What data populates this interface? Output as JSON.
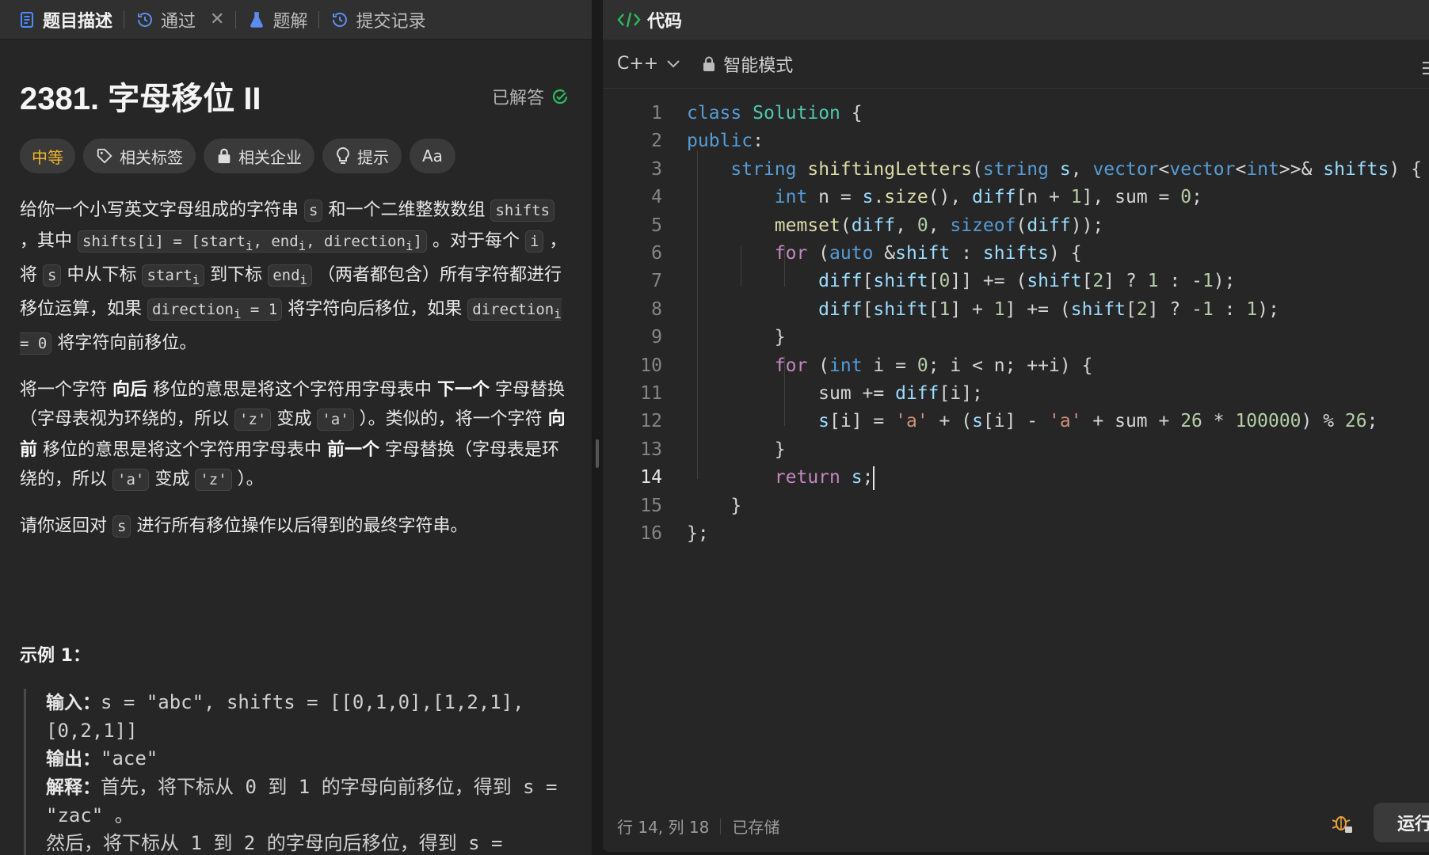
{
  "left_tabs": [
    {
      "label": "题目描述",
      "icon": "document-icon"
    },
    {
      "label": "通过",
      "icon": "history-icon"
    },
    {
      "label": "题解",
      "icon": "flask-icon"
    },
    {
      "label": "提交记录",
      "icon": "history-icon"
    }
  ],
  "problem": {
    "title": "2381. 字母移位 II",
    "status": "已解答",
    "difficulty": "中等",
    "chips": [
      "相关标签",
      "相关企业",
      "提示",
      "Aa"
    ],
    "colors": {
      "difficulty": "#f0b429",
      "solved": "#2cbb5d"
    }
  },
  "description": {
    "p1": {
      "t1": "给你一个小写英文字母组成的字符串 ",
      "c1": "s",
      "t2": " 和一个二维整数数组 ",
      "c2": "shifts",
      "t3": " ，其中 ",
      "c3": "shifts[i] = [start",
      "c3b": ", end",
      "c3c": ", direction",
      "c3d": "]",
      "t4": " 。对于每个 ",
      "c4": "i",
      "t5": " ，将 ",
      "c5": "s",
      "t6": " 中从下标 ",
      "c6": "start",
      "t7": " 到下标 ",
      "c7": "end",
      "t8": " （两者都包含）所有字符都进行移位运算，如果 ",
      "c8": "direction",
      "c8b": " = 1",
      "t9": " 将字符向后移位，如果 ",
      "c9": "direction",
      "c9b": " = 0",
      "t10": " 将字符向前移位。",
      "sub": "i"
    },
    "p2": {
      "t1": "将一个字符 ",
      "b1": "向后",
      "t2": " 移位的意思是将这个字符用字母表中 ",
      "b2": "下一个",
      "t3": " 字母替换（字母表视为环绕的，所以 ",
      "c1": "'z'",
      "t4": " 变成 ",
      "c2": "'a'",
      "t5": " ）。类似的，将一个字符 ",
      "b3": "向前",
      "t6": " 移位的意思是将这个字符用字母表中 ",
      "b4": "前一个",
      "t7": " 字母替换（字母表是环绕的，所以 ",
      "c3": "'a'",
      "t8": " 变成 ",
      "c4": "'z'",
      "t9": " ）。"
    },
    "p3": {
      "t1": "请你返回对 ",
      "c1": "s",
      "t2": " 进行所有移位操作以后得到的最终字符串。"
    }
  },
  "example": {
    "title": "示例 1：",
    "input_label": "输入：",
    "input_value": "s = \"abc\", shifts = [[0,1,0],[1,2,1],[0,2,1]]",
    "output_label": "输出：",
    "output_value": "\"ace\"",
    "explain_label": "解释：",
    "explain_value": "首先，将下标从 0 到 1 的字母向前移位，得到 s = \"zac\" 。",
    "explain_more": "然后，将下标从 1 到 2 的字母向后移位，得到 s ="
  },
  "editor": {
    "header": "代码",
    "language": "C++",
    "mode": "智能模式",
    "current_line": 14,
    "lines": [
      "class Solution {",
      "public:",
      "    string shiftingLetters(string s, vector<vector<int>>& shifts) {",
      "        int n = s.size(), diff[n + 1], sum = 0;",
      "        memset(diff, 0, sizeof(diff));",
      "        for (auto &shift : shifts) {",
      "            diff[shift[0]] += (shift[2] ? 1 : -1);",
      "            diff[shift[1] + 1] += (shift[2] ? -1 : 1);",
      "        }",
      "        for (int i = 0; i < n; ++i) {",
      "            sum += diff[i];",
      "            s[i] = 'a' + (s[i] - 'a' + sum + 26 * 100000) % 26;",
      "        }",
      "        return s;",
      "    }",
      "};"
    ]
  },
  "status_bar": {
    "position": "行 14, 列 18",
    "saved": "已存储",
    "run_label": "运行"
  }
}
